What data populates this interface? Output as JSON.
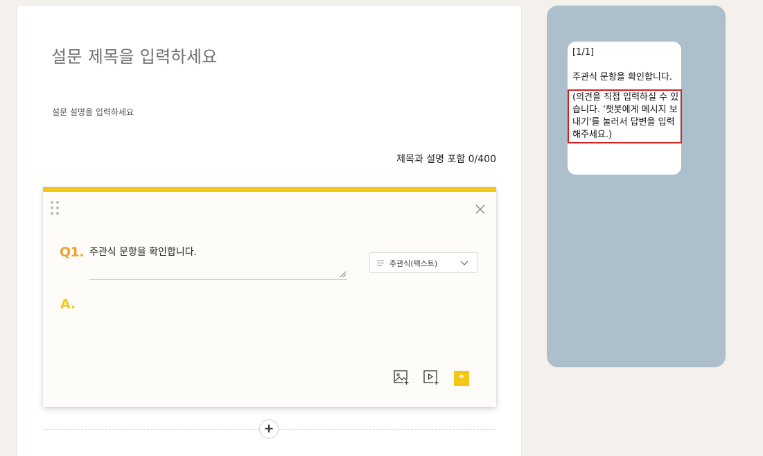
{
  "survey": {
    "title_placeholder": "설문 제목을 입력하세요",
    "description_placeholder": "설문 설명을 입력하세요",
    "char_count": "제목과 설명 포함 0/400"
  },
  "question": {
    "number_label": "Q1.",
    "text": "주관식 문항을 확인합니다.",
    "answer_label": "A.",
    "type_select": {
      "selected": "주관식(텍스트)"
    },
    "tools": {
      "required_symbol": "*"
    }
  },
  "add_question": {
    "symbol": "+"
  },
  "preview": {
    "page_indicator": "[1/1]",
    "question_text": "주관식 문항을 확인합니다.",
    "hint_text": "(의견을 직접 입력하실 수 있습니다. '챗봇에게 메시지 보내기'를 눌러서 답변을 입력해주세요.)"
  },
  "colors": {
    "accent_yellow": "#f5c518",
    "question_orange": "#f0a22e",
    "preview_bg": "#aebfcc",
    "highlight_red": "#d42020"
  },
  "icons": {
    "drag": "drag-handle-icon",
    "close": "close-icon",
    "type": "text-lines-icon",
    "dropdown": "chevron-down-icon",
    "image": "add-image-icon",
    "video": "add-video-icon",
    "required": "required-asterisk-icon",
    "add": "plus-icon"
  }
}
